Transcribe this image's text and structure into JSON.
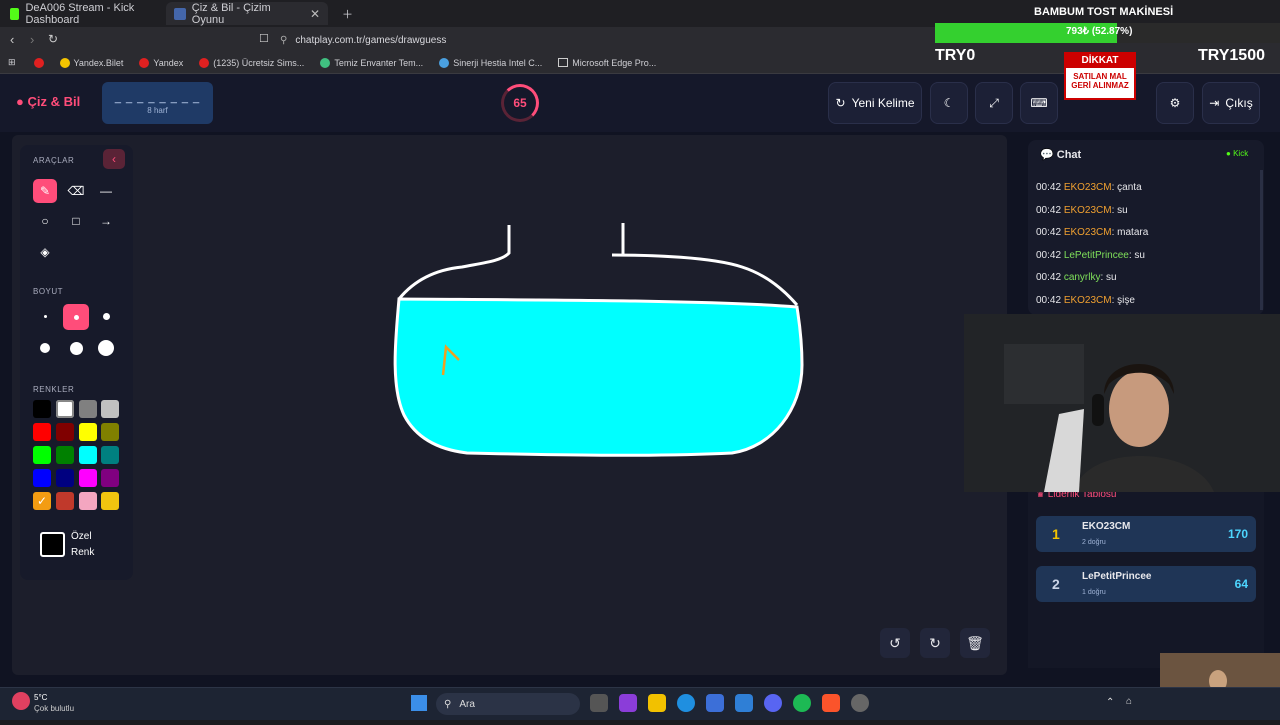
{
  "browser": {
    "tabs": [
      {
        "title": "DeA006 Stream - Kick Dashboard"
      },
      {
        "title": "Çiz & Bil - Çizim Oyunu"
      }
    ],
    "url": "chatplay.com.tr/games/drawguess",
    "bookmarks": [
      "Yandex.Bilet",
      "Yandex",
      "(1235) Ücretsiz Sims...",
      "Temiz Envanter Tem...",
      "Sinerji Hestia Intel C...",
      "Microsoft Edge Pro..."
    ]
  },
  "overlay": {
    "title": "BAMBUM TOST MAKİNESİ",
    "progress_text": "793₺ (52.87%)",
    "progress_fraction": 0.5287,
    "left_amount": "TRY0",
    "right_amount": "TRY1500",
    "sign": {
      "top": "DİKKAT",
      "line1": "SATILAN MAL",
      "line2": "GERİ ALINMAZ"
    }
  },
  "app": {
    "logo": "Çiz & Bil",
    "word_mask": "_ _ _ _ _ _ _ _",
    "word_hint": "8 harf",
    "timer": "65",
    "new_word": "Yeni Kelime",
    "exit": "Çıkış"
  },
  "tools": {
    "section_tools": "ARAÇLAR",
    "section_size": "BOYUT",
    "section_colors": "RENKLER",
    "custom_color_line1": "Özel",
    "custom_color_line2": "Renk",
    "palette": [
      "#000000",
      "#ffffff",
      "#808080",
      "#c0c0c0",
      "#ff0000",
      "#800000",
      "#ffff00",
      "#808000",
      "#00ff00",
      "#008000",
      "#00ffff",
      "#008080",
      "#0000ff",
      "#000080",
      "#ff00ff",
      "#800080",
      "#f39c12",
      "#c0392b",
      "#f4a6c0",
      "#f1c40f"
    ]
  },
  "chat": {
    "title": "Chat",
    "platform": "Kick",
    "messages": [
      {
        "time": "00:42",
        "user": "EKO23CM",
        "text": ": çanta",
        "color": "#f0a030"
      },
      {
        "time": "00:42",
        "user": "EKO23CM",
        "text": ": su",
        "color": "#f0a030"
      },
      {
        "time": "00:42",
        "user": "EKO23CM",
        "text": ": matara",
        "color": "#f0a030"
      },
      {
        "time": "00:42",
        "user": "LePetitPrincee",
        "text": ": su",
        "color": "#7fe05a"
      },
      {
        "time": "00:42",
        "user": "canyrlky",
        "text": ": su",
        "color": "#7fe05a"
      },
      {
        "time": "00:42",
        "user": "EKO23CM",
        "text": ": şişe",
        "color": "#f0a030"
      }
    ]
  },
  "leaderboard": {
    "title": "Liderlik Tablosu",
    "rows": [
      {
        "rank": "1",
        "name": "EKO23CM",
        "sub": "2 doğru",
        "score": "170"
      },
      {
        "rank": "2",
        "name": "LePetitPrincee",
        "sub": "1 doğru",
        "score": "64"
      }
    ]
  },
  "taskbar": {
    "weather_temp": "5°C",
    "weather_desc": "Çok bulutlu",
    "search": "Ara"
  }
}
